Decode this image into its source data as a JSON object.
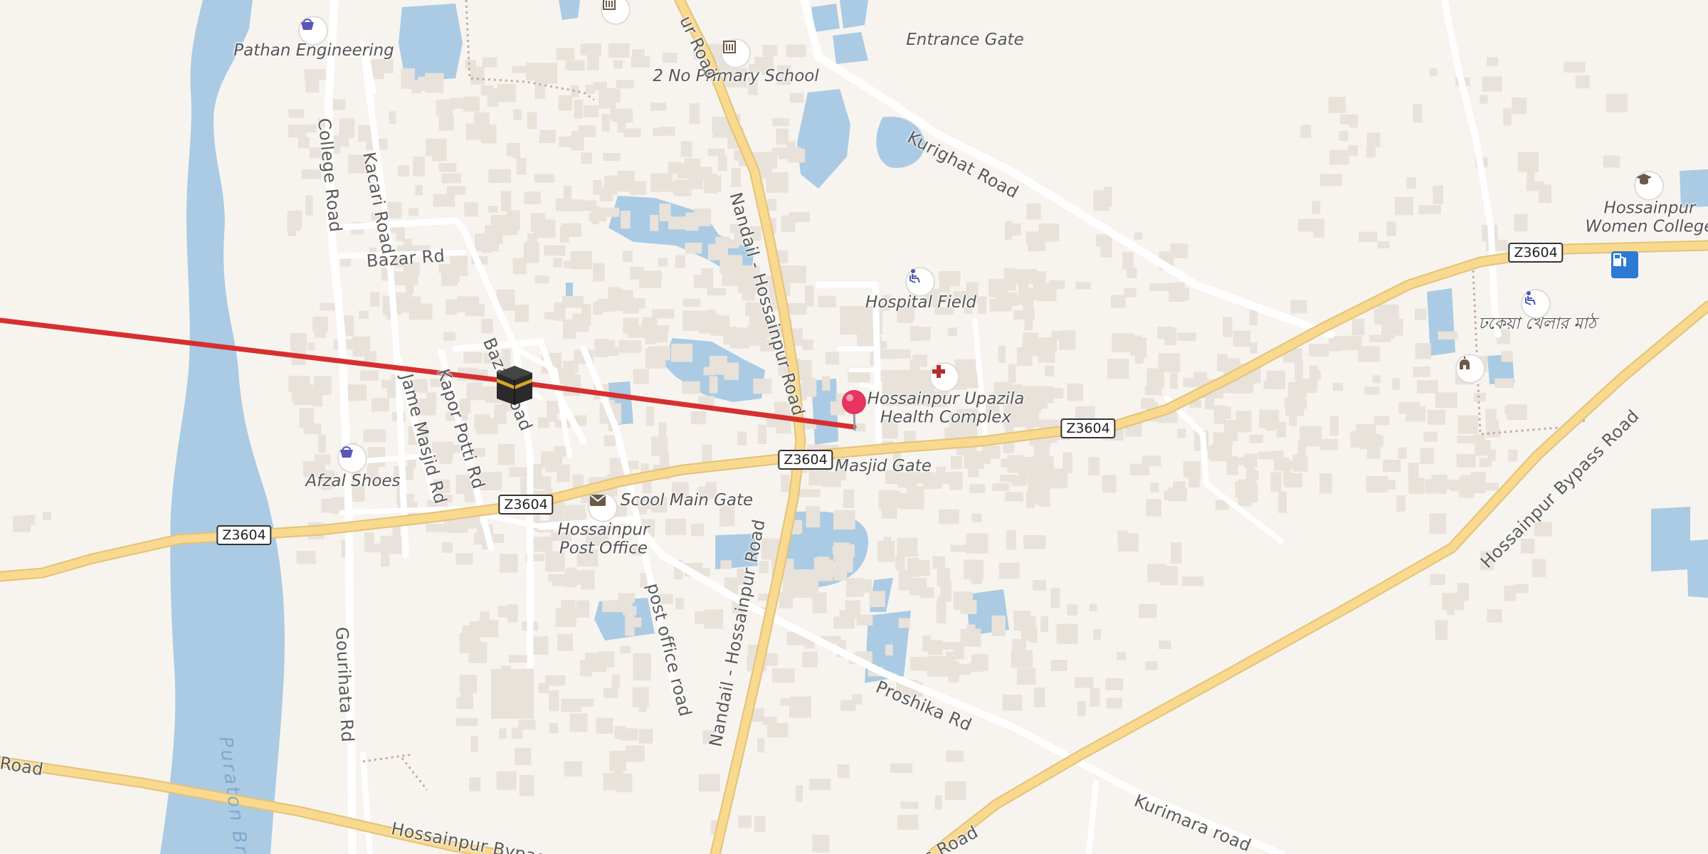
{
  "map": {
    "colors": {
      "land": "#f7f4ef",
      "water": "#aacbe3",
      "building": "#e8e2da",
      "major_road": "#f8d98e",
      "minor_road": "#ffffff",
      "route_line": "#d62f2f",
      "pin": "#e8345e"
    },
    "places": {
      "pathan_engineering": "Pathan Engineering",
      "entrance_gate": "Entrance Gate",
      "primary_school": "2 No Primary School",
      "hospital_field": "Hospital Field",
      "health_complex_1": "Hossainpur Upazila",
      "health_complex_2": "Health Complex",
      "masjid_gate": "Masjid Gate",
      "women_college_1": "Hossainpur",
      "women_college_2": "Women College",
      "play_ground": "ঢকেয়া খেলার মাঠ",
      "afzal_shoes": "Afzal Shoes",
      "school_main_gate": "Scool Main Gate",
      "post_office_1": "Hossainpur",
      "post_office_2": "Post Office"
    },
    "roads": {
      "college_road": "College Road",
      "kacari_road": "Kacari Road",
      "bazar_rd": "Bazar Rd",
      "bazar_road": "Bazar Road",
      "jame_masjid_rd": "Jame Masjid Rd",
      "kapor_potti_rd": "Kapor Potti Rd",
      "nandail_upper": "Nandail - Hossainpur Road",
      "nandail_lower": "Nandail - Hossainpur Road",
      "kurighat_road": "Kurighat Road",
      "post_office_road": "post office road",
      "gourihata_rd": "Gourihata Rd",
      "proshika_rd": "Proshika Rd",
      "kurimara_road": "Kurimara road",
      "bypass_road_ne": "Hossainpur Bypass Road",
      "bypass_road_sw": "Hossainpur Bypass R",
      "road_left": "Road",
      "road_bottom": "s Road",
      "road_top": "ur Road"
    },
    "water_labels": {
      "puraton": "Puraton Br"
    },
    "shields": [
      "Z3604",
      "Z3604",
      "Z3604",
      "Z3604",
      "Z3604"
    ],
    "icons": {
      "shop": "shopping-basket-icon",
      "school": "school-icon",
      "college": "graduation-cap-icon",
      "sports": "sports-field-icon",
      "hospital": "hospital-cross-icon",
      "post": "post-office-envelope-icon",
      "mosque": "mosque-kaaba-icon",
      "temple": "temple-icon",
      "fuel": "fuel-station-icon",
      "pin": "location-pin-icon"
    }
  }
}
